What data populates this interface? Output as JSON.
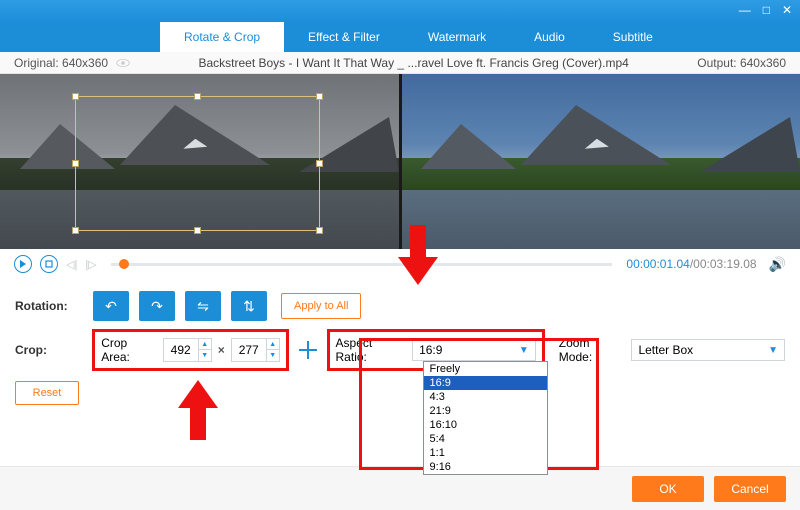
{
  "window": {
    "minimize": "—",
    "maximize": "□",
    "close": "✕"
  },
  "tabs": [
    "Rotate & Crop",
    "Effect & Filter",
    "Watermark",
    "Audio",
    "Subtitle"
  ],
  "active_tab": 0,
  "info": {
    "original_label": "Original: 640x360",
    "filename": "Backstreet Boys - I Want It That Way _ ...ravel Love ft. Francis Greg (Cover).mp4",
    "output_label": "Output: 640x360"
  },
  "playback": {
    "current": "00:00:01.04",
    "duration": "/00:03:19.08"
  },
  "rotation": {
    "label": "Rotation:",
    "apply_all": "Apply to All"
  },
  "crop": {
    "label": "Crop:",
    "area_label": "Crop Area:",
    "width": "492",
    "height": "277",
    "reset": "Reset"
  },
  "aspect": {
    "label": "Aspect Ratio:",
    "selected": "16:9",
    "options": [
      "Freely",
      "16:9",
      "4:3",
      "21:9",
      "16:10",
      "5:4",
      "1:1",
      "9:16"
    ]
  },
  "zoom": {
    "label": "Zoom Mode:",
    "value": "Letter Box"
  },
  "footer": {
    "ok": "OK",
    "cancel": "Cancel"
  }
}
